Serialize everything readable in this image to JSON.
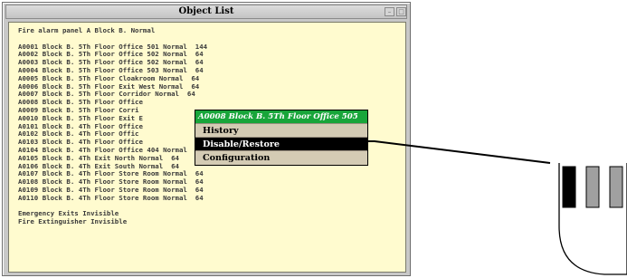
{
  "window": {
    "title": "Object List",
    "minimize_glyph": "–",
    "maximize_glyph": "□"
  },
  "list": {
    "header": "Fire alarm panel A Block B. Normal",
    "entries": [
      "A0001 Block B. 5Th Floor Office 501 Normal  144",
      "A0002 Block B. 5Th Floor Office 502 Normal  64",
      "A0003 Block B. 5Th Floor Office 502 Normal  64",
      "A0004 Block B. 5Th Floor Office 503 Normal  64",
      "A0005 Block B. 5Th Floor Cloakroom Normal  64",
      "A0006 Block B. 5Th Floor Exit West Normal  64",
      "A0007 Block B. 5Th Floor Corridor Normal  64",
      "A0008 Block B. 5Th Floor Office",
      "A0009 Block B. 5Th Floor Corri",
      "A0010 Block B. 5Th Floor Exit E",
      "A0101 Block B. 4Th Floor Office",
      "A0102 Block B. 4Th Floor Offic",
      "A0103 Block B. 4Th Floor Office",
      "A0104 Block B. 4Th Floor Office 404 Normal  64",
      "A0105 Block B. 4Th Exit North Normal  64",
      "A0106 Block B. 4Th Exit South Normal  64",
      "A0107 Block B. 4Th Floor Store Room Normal  64",
      "A0108 Block B. 4Th Floor Store Room Normal  64",
      "A0109 Block B. 4Th Floor Store Room Normal  64",
      "A0110 Block B. 4Th Floor Store Room Normal  64"
    ],
    "footer": [
      "Emergency Exits Invisible",
      "Fire Extinguisher Invisible"
    ]
  },
  "context_menu": {
    "title": "A0008 Block B. 5Th Floor Office 505",
    "title_color": "#18a53a",
    "items": [
      {
        "label": "History",
        "selected": false
      },
      {
        "label": "Disable/Restore",
        "selected": true
      },
      {
        "label": "Configuration",
        "selected": false
      }
    ]
  },
  "device_icon": {
    "name": "detector-device-icon"
  }
}
